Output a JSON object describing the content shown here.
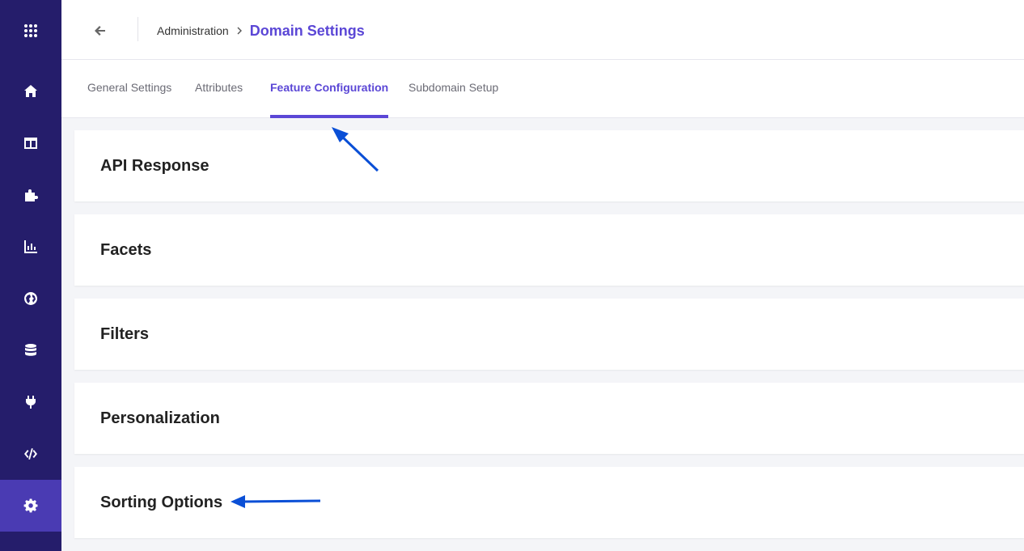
{
  "sidebar": {
    "items": [
      {
        "icon": "apps-grid-icon"
      },
      {
        "icon": "home-icon"
      },
      {
        "icon": "layout-icon"
      },
      {
        "icon": "puzzle-icon"
      },
      {
        "icon": "bar-chart-icon"
      },
      {
        "icon": "globe-icon"
      },
      {
        "icon": "database-icon"
      },
      {
        "icon": "plug-icon"
      },
      {
        "icon": "code-icon"
      },
      {
        "icon": "gear-icon",
        "active": true
      }
    ],
    "background_color": "#251d6b",
    "active_color": "#4a3bb3"
  },
  "header": {
    "back_icon": "arrow-left-icon",
    "breadcrumb": {
      "parent": "Administration",
      "current": "Domain Settings"
    }
  },
  "tabs": [
    {
      "label": "General Settings"
    },
    {
      "label": "Attributes"
    },
    {
      "label": "Feature Configuration",
      "active": true
    },
    {
      "label": "Subdomain Setup"
    }
  ],
  "panels": [
    {
      "title": "API Response"
    },
    {
      "title": "Facets"
    },
    {
      "title": "Filters"
    },
    {
      "title": "Personalization"
    },
    {
      "title": "Sorting Options"
    }
  ],
  "annotation_color": "#0a4fd6",
  "accent_color": "#5b47d6"
}
